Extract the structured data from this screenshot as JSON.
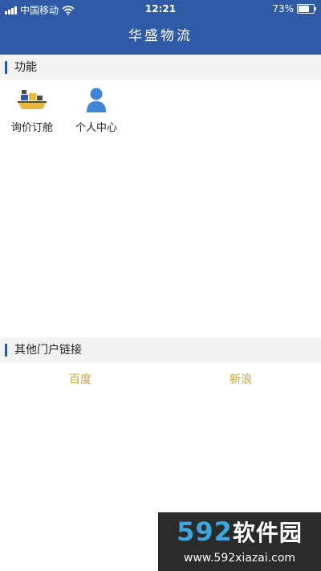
{
  "status_bar": {
    "carrier": "中国移动",
    "time": "12:21",
    "battery": "73%",
    "battery_level": 0.73
  },
  "nav": {
    "title": "华盛物流"
  },
  "features": {
    "title": "功能",
    "items": [
      {
        "label": "询价订舱",
        "icon": "cargo-ship-icon"
      },
      {
        "label": "个人中心",
        "icon": "user-icon"
      }
    ]
  },
  "portal_links": {
    "title": "其他门户链接",
    "items": [
      {
        "label": "百度"
      },
      {
        "label": "新浪"
      }
    ]
  },
  "watermark": {
    "brand_number": "592",
    "brand_text": "软件园",
    "url": "www.592xiazai.com"
  },
  "colors": {
    "brand_blue": "#2f5aa7",
    "link_gold": "#d4a32a",
    "section_bg": "#f3f3f3"
  }
}
